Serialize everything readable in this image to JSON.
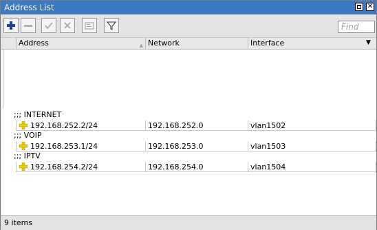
{
  "window": {
    "title": "Address List"
  },
  "toolbar": {
    "buttons": [
      {
        "icon": "plus-icon",
        "name": "add"
      },
      {
        "icon": "minus-icon",
        "name": "remove"
      },
      {
        "icon": "check-icon",
        "name": "enable"
      },
      {
        "icon": "x-icon",
        "name": "disable"
      },
      {
        "icon": "comment-icon",
        "name": "comment"
      },
      {
        "icon": "filter-icon",
        "name": "filter"
      }
    ],
    "find_placeholder": "Find"
  },
  "table": {
    "columns": [
      "Address",
      "Network",
      "Interface"
    ],
    "groups": [
      {
        "comment": ";;; INTERNET",
        "address": "192.168.252.2/24",
        "network": "192.168.252.0",
        "interface": "vlan1502"
      },
      {
        "comment": ";;; VOIP",
        "address": "192.168.253.1/24",
        "network": "192.168.253.0",
        "interface": "vlan1503"
      },
      {
        "comment": ";;; IPTV",
        "address": "192.168.254.2/24",
        "network": "192.168.254.0",
        "interface": "vlan1504"
      }
    ]
  },
  "status": {
    "text": "9 items"
  },
  "colors": {
    "titlebar": "#3a79c4",
    "add_icon": "#1a3fa0",
    "address_icon": "#e8d000"
  }
}
